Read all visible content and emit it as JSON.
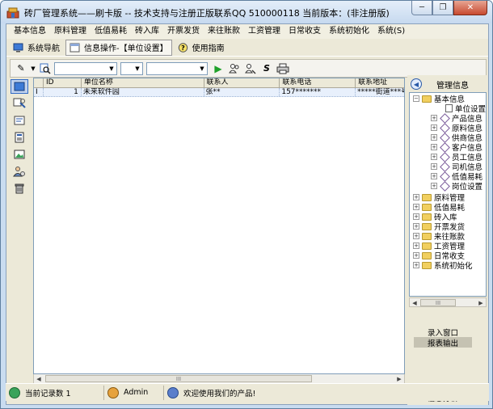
{
  "window": {
    "title": "砖厂管理系统——刷卡版 -- 技术支持与注册正版联系QQ 510000118    当前版本：(非注册版)",
    "min_label": "─",
    "restore_label": "❐",
    "close_label": "✕"
  },
  "menu": [
    "基本信息",
    "原料管理",
    "低值易耗",
    "砖入库",
    "开票发货",
    "来往账款",
    "工资管理",
    "日常收支",
    "系统初始化",
    "系统(S)"
  ],
  "tabs": {
    "nav_label": "系统导航",
    "active_label": "信息操作-【单位设置】",
    "guide_label": "使用指南"
  },
  "grid": {
    "columns": [
      "ID",
      "单位名称",
      "联系人",
      "联系电话",
      "联系地址"
    ],
    "rows": [
      {
        "indicator": "I",
        "id": "1",
        "name": "未来软件园",
        "contact": "张**",
        "phone": "157*******",
        "address": "*****街道***号"
      }
    ]
  },
  "scroll_thumb_label": "III",
  "nav": {
    "first": "|<",
    "last": "▶|",
    "edit": "/",
    "confirm": "✓",
    "cancel": "✕"
  },
  "right_panel": {
    "title": "管理信息",
    "tree": [
      {
        "label": "基本信息",
        "level": 0,
        "expanded": true,
        "kind": "folder"
      },
      {
        "label": "单位设置",
        "level": 2,
        "kind": "doc"
      },
      {
        "label": "产品信息",
        "level": 1,
        "kind": "leaf"
      },
      {
        "label": "原料信息",
        "level": 1,
        "kind": "leaf"
      },
      {
        "label": "供商信息",
        "level": 1,
        "kind": "leaf"
      },
      {
        "label": "客户信息",
        "level": 1,
        "kind": "leaf"
      },
      {
        "label": "员工信息",
        "level": 1,
        "kind": "leaf"
      },
      {
        "label": "司机信息",
        "level": 1,
        "kind": "leaf"
      },
      {
        "label": "低值易耗",
        "level": 1,
        "kind": "leaf"
      },
      {
        "label": "岗位设置",
        "level": 1,
        "kind": "leaf"
      },
      {
        "label": "原料管理",
        "level": 0,
        "kind": "folder"
      },
      {
        "label": "低值易耗",
        "level": 0,
        "kind": "folder"
      },
      {
        "label": "砖入库",
        "level": 0,
        "kind": "folder"
      },
      {
        "label": "开票发货",
        "level": 0,
        "kind": "folder"
      },
      {
        "label": "来往账款",
        "level": 0,
        "kind": "folder"
      },
      {
        "label": "工资管理",
        "level": 0,
        "kind": "folder"
      },
      {
        "label": "日常收支",
        "level": 0,
        "kind": "folder"
      },
      {
        "label": "系统初始化",
        "level": 0,
        "kind": "folder"
      }
    ],
    "buttons": [
      "录入窗口",
      "报表输出"
    ],
    "bottom_label": "信息分析"
  },
  "status": {
    "record_count": "当前记录数 1",
    "user": "Admin",
    "welcome": "欢迎使用我们的产品!"
  }
}
